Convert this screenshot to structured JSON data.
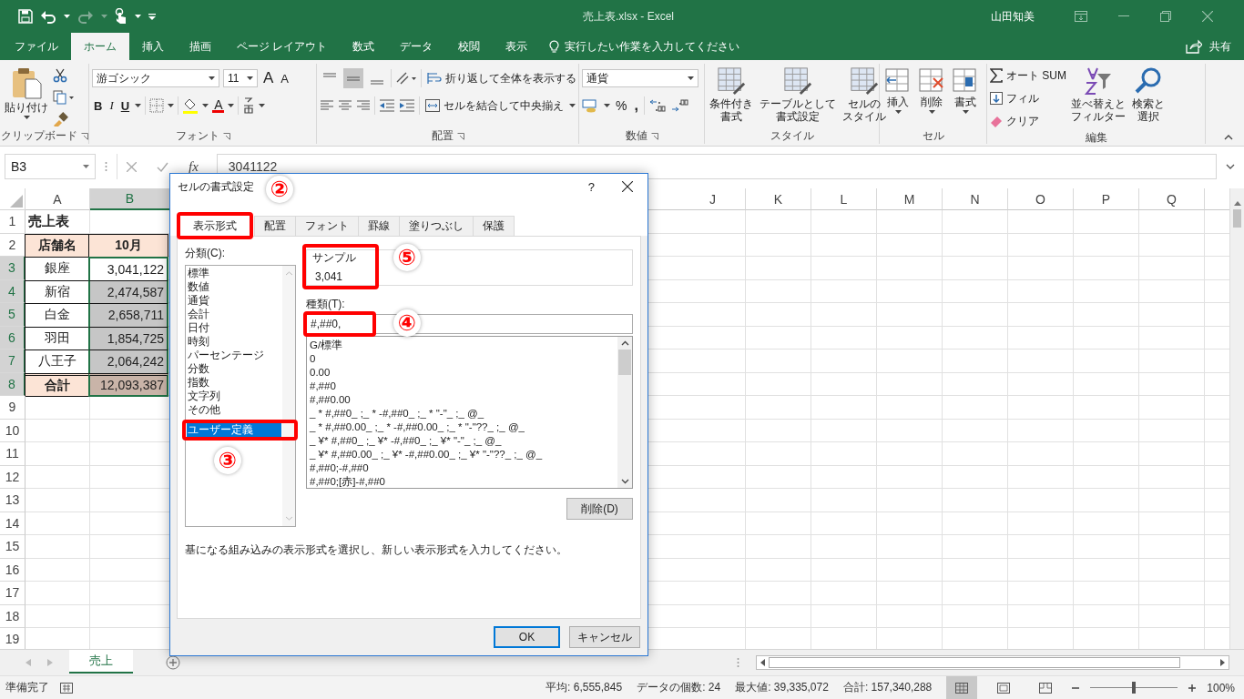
{
  "window": {
    "title": "売上表.xlsx - Excel",
    "user": "山田知美"
  },
  "ribbon": {
    "tabs": [
      {
        "label": "ファイル",
        "selected": false
      },
      {
        "label": "ホーム",
        "selected": true
      },
      {
        "label": "挿入",
        "selected": false
      },
      {
        "label": "描画",
        "selected": false
      },
      {
        "label": "ページ レイアウト",
        "selected": false
      },
      {
        "label": "数式",
        "selected": false
      },
      {
        "label": "データ",
        "selected": false
      },
      {
        "label": "校閲",
        "selected": false
      },
      {
        "label": "表示",
        "selected": false
      }
    ],
    "tell_me": "実行したい作業を入力してください",
    "share": "共有",
    "clipboard": {
      "paste": "貼り付け",
      "label": "クリップボード"
    },
    "font": {
      "name": "游ゴシック",
      "size": "11",
      "grow": "A",
      "shrink": "A",
      "bold": "B",
      "italic": "I",
      "underline": "U",
      "color_button": "A",
      "label": "フォント"
    },
    "alignment": {
      "vertical": [
        {
          "selected": false
        },
        {
          "selected": true
        },
        {
          "selected": false
        }
      ],
      "wrap": "折り返して全体を表示する",
      "merge": "セルを結合して中央揃え",
      "label": "配置"
    },
    "number": {
      "format": "通貨",
      "percent": "%",
      "comma": ",",
      "label": "数値"
    },
    "styles": {
      "buttons": [
        {
          "lines": [
            "条件付き",
            "書式"
          ]
        },
        {
          "lines": [
            "テーブルとして",
            "書式設定"
          ]
        },
        {
          "lines": [
            "セルの",
            "スタイル"
          ]
        }
      ],
      "label": "スタイル"
    },
    "cells": {
      "buttons": [
        {
          "lines": [
            "挿入"
          ]
        },
        {
          "lines": [
            "削除"
          ]
        },
        {
          "lines": [
            "書式"
          ]
        }
      ],
      "label": "セル"
    },
    "editing": {
      "small": [
        "オート SUM",
        "フィル",
        "クリア"
      ],
      "buttons": [
        {
          "lines": [
            "並べ替えと",
            "フィルター"
          ]
        },
        {
          "lines": [
            "検索と",
            "選択"
          ]
        }
      ],
      "label": "編集"
    }
  },
  "formula_bar": {
    "name_box": "B3",
    "fx": "fx",
    "formula": "3041122"
  },
  "sheet": {
    "columns": [
      {
        "label": "A",
        "selected": false
      },
      {
        "label": "B",
        "selected": true
      },
      {
        "label": "J",
        "selected": false
      },
      {
        "label": "K",
        "selected": false
      },
      {
        "label": "L",
        "selected": false
      },
      {
        "label": "M",
        "selected": false
      },
      {
        "label": "N",
        "selected": false
      },
      {
        "label": "O",
        "selected": false
      },
      {
        "label": "P",
        "selected": false
      },
      {
        "label": "Q",
        "selected": false
      }
    ],
    "rows": [
      {
        "number": "1",
        "selected": false,
        "cells": [
          {
            "text": "売上表",
            "kind": "title"
          }
        ]
      },
      {
        "number": "2",
        "selected": false,
        "cells": [
          {
            "text": "店舗名",
            "kind": "header",
            "selected": false
          },
          {
            "text": "10月",
            "kind": "header",
            "selected": false
          }
        ]
      },
      {
        "number": "3",
        "selected": true,
        "cells": [
          {
            "text": "銀座",
            "kind": "body",
            "selected": false
          },
          {
            "text": "3,041,122",
            "kind": "number",
            "selected": false
          }
        ]
      },
      {
        "number": "4",
        "selected": true,
        "cells": [
          {
            "text": "新宿",
            "kind": "body",
            "selected": false
          },
          {
            "text": "2,474,587",
            "kind": "number",
            "selected": true
          }
        ]
      },
      {
        "number": "5",
        "selected": true,
        "cells": [
          {
            "text": "白金",
            "kind": "body",
            "selected": false
          },
          {
            "text": "2,658,711",
            "kind": "number",
            "selected": true
          }
        ]
      },
      {
        "number": "6",
        "selected": true,
        "cells": [
          {
            "text": "羽田",
            "kind": "body",
            "selected": false
          },
          {
            "text": "1,854,725",
            "kind": "number",
            "selected": true
          }
        ]
      },
      {
        "number": "7",
        "selected": true,
        "cells": [
          {
            "text": "八王子",
            "kind": "body",
            "selected": false
          },
          {
            "text": "2,064,242",
            "kind": "number",
            "selected": true
          }
        ]
      },
      {
        "number": "8",
        "selected": true,
        "cells": [
          {
            "text": "合計",
            "kind": "total",
            "selected": false
          },
          {
            "text": "12,093,387",
            "kind": "total_number",
            "selected": true
          }
        ]
      },
      {
        "number": "9",
        "selected": false
      },
      {
        "number": "10",
        "selected": false
      },
      {
        "number": "11",
        "selected": false
      },
      {
        "number": "12",
        "selected": false
      },
      {
        "number": "13",
        "selected": false
      },
      {
        "number": "14",
        "selected": false
      },
      {
        "number": "15",
        "selected": false
      },
      {
        "number": "16",
        "selected": false
      },
      {
        "number": "17",
        "selected": false
      },
      {
        "number": "18",
        "selected": false
      },
      {
        "number": "19",
        "selected": false
      }
    ]
  },
  "sheet_tabs": [
    {
      "label": "売上",
      "selected": true
    }
  ],
  "status_bar": {
    "ready": "準備完了",
    "stats": [
      "平均: 6,555,845",
      "データの個数: 24",
      "最大値: 39,335,072",
      "合計: 157,340,288"
    ],
    "views": [
      {
        "selected": true
      },
      {
        "selected": false
      },
      {
        "selected": false
      }
    ],
    "zoom": {
      "level": 0.5,
      "reading": "100%"
    }
  },
  "dialog": {
    "title": "セルの書式設定",
    "help": "?",
    "tabs": [
      {
        "label": "表示形式",
        "selected": true,
        "callout": "②"
      },
      {
        "label": "配置",
        "selected": false
      },
      {
        "label": "フォント",
        "selected": false
      },
      {
        "label": "罫線",
        "selected": false
      },
      {
        "label": "塗りつぶし",
        "selected": false
      },
      {
        "label": "保護",
        "selected": false
      }
    ],
    "category_label": "分類(C):",
    "categories": [
      {
        "label": "標準",
        "selected": false
      },
      {
        "label": "数値",
        "selected": false
      },
      {
        "label": "通貨",
        "selected": false
      },
      {
        "label": "会計",
        "selected": false
      },
      {
        "label": "日付",
        "selected": false
      },
      {
        "label": "時刻",
        "selected": false
      },
      {
        "label": "パーセンテージ",
        "selected": false
      },
      {
        "label": "分数",
        "selected": false
      },
      {
        "label": "指数",
        "selected": false
      },
      {
        "label": "文字列",
        "selected": false
      },
      {
        "label": "その他",
        "selected": false
      },
      {
        "label": "ユーザー定義",
        "selected": true,
        "callout": "③"
      }
    ],
    "sample": {
      "label": "サンプル",
      "value": "3,041",
      "callout": "⑤"
    },
    "type": {
      "label": "種類(T):",
      "value": "#,##0,",
      "callout": "④"
    },
    "formats": [
      "G/標準",
      "0",
      "0.00",
      "#,##0",
      "#,##0.00",
      "_ * #,##0_ ;_ * -#,##0_ ;_ * \"-\"_ ;_ @_",
      "_ * #,##0.00_ ;_ * -#,##0.00_ ;_ * \"-\"??_ ;_ @_",
      "_ ¥* #,##0_ ;_ ¥* -#,##0_ ;_ ¥* \"-\"_ ;_ @_",
      "_ ¥* #,##0.00_ ;_ ¥* -#,##0.00_ ;_ ¥* \"-\"??_ ;_ @_",
      "#,##0;-#,##0",
      "#,##0;[赤]-#,##0"
    ],
    "delete": "削除(D)",
    "description": "基になる組み込みの表示形式を選択し、新しい表示形式を入力してください。",
    "ok": "OK",
    "cancel": "キャンセル"
  }
}
